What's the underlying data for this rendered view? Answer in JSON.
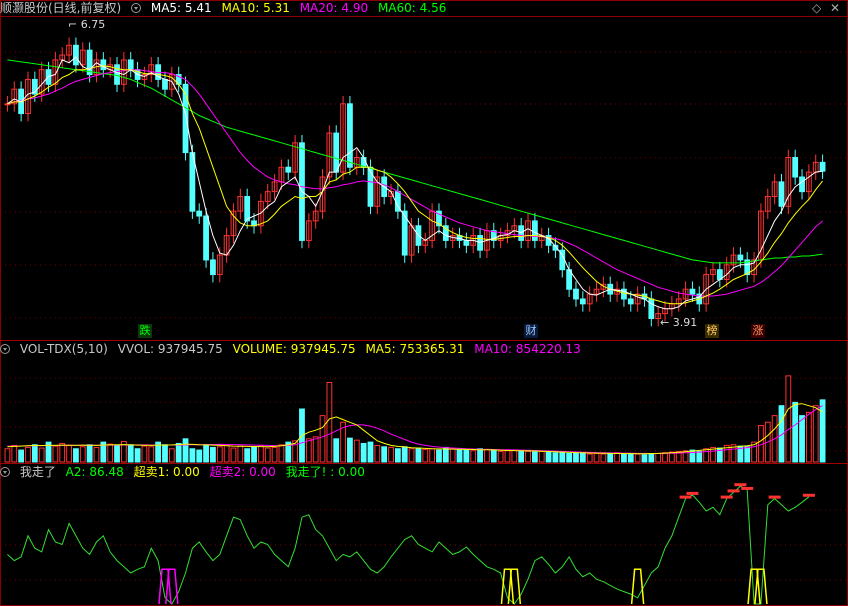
{
  "top": {
    "title": "顺灏股份(日线,前复权)",
    "ma5": "MA5: 5.41",
    "ma10": "MA10: 5.31",
    "ma20": "MA20: 4.90",
    "ma60": "MA60: 4.56",
    "high_mark": "6.75",
    "low_mark": "3.91",
    "tags": [
      "跌",
      "财",
      "榜",
      "涨"
    ]
  },
  "vol": {
    "title": "VOL-TDX(5,10)",
    "vvol": "VVOL: 937945.75",
    "volume": "VOLUME: 937945.75",
    "ma5": "MA5: 753365.31",
    "ma10": "MA10: 854220.13"
  },
  "ind": {
    "title": "我走了",
    "a2": "A2: 86.48",
    "s1": "超卖1: 0.00",
    "s2": "超卖2: 0.00",
    "go": "我走了! : 0.00"
  },
  "colors": {
    "up": "#ff3232",
    "down": "#54ffff",
    "ma5": "#ffffff",
    "ma10": "#ffff00",
    "ma20": "#ff00ff",
    "ma60": "#00ff00",
    "grid": "#7a0000"
  },
  "chart_data": [
    {
      "type": "candlestick",
      "title": "顺灏股份(日线,前复权)",
      "ylim": [
        3.7,
        7.0
      ],
      "annotations": [
        {
          "label": "6.75",
          "kind": "high"
        },
        {
          "label": "3.91",
          "kind": "low"
        }
      ],
      "close": [
        6.1,
        6.25,
        6.0,
        6.35,
        6.2,
        6.45,
        6.3,
        6.55,
        6.6,
        6.7,
        6.5,
        6.65,
        6.4,
        6.55,
        6.45,
        6.5,
        6.3,
        6.55,
        6.45,
        6.35,
        6.4,
        6.5,
        6.35,
        6.25,
        6.4,
        6.3,
        5.6,
        5.0,
        4.95,
        4.5,
        4.35,
        4.55,
        4.75,
        5.0,
        5.15,
        4.9,
        4.85,
        5.1,
        5.2,
        5.3,
        5.45,
        5.4,
        5.7,
        4.7,
        4.9,
        5.0,
        5.35,
        5.8,
        5.4,
        6.1,
        5.45,
        5.55,
        5.45,
        5.05,
        5.35,
        5.15,
        5.2,
        5.0,
        4.55,
        4.85,
        4.65,
        4.7,
        5.0,
        4.85,
        4.7,
        4.75,
        4.7,
        4.65,
        4.75,
        4.6,
        4.8,
        4.7,
        4.75,
        4.8,
        4.85,
        4.7,
        4.9,
        4.7,
        4.75,
        4.65,
        4.6,
        4.4,
        4.2,
        4.1,
        4.05,
        4.15,
        4.2,
        4.25,
        4.15,
        4.2,
        4.1,
        4.05,
        4.15,
        4.1,
        3.9,
        3.95,
        4.0,
        4.05,
        4.1,
        4.2,
        4.15,
        4.05,
        4.35,
        4.4,
        4.3,
        4.45,
        4.55,
        4.5,
        4.35,
        4.5,
        5.0,
        5.15,
        5.3,
        5.05,
        5.55,
        5.35,
        5.2,
        5.4,
        5.5,
        5.41
      ],
      "ma5": [
        6.1,
        6.15,
        6.12,
        6.2,
        6.22,
        6.3,
        6.38,
        6.4,
        6.55,
        6.52,
        6.58,
        6.48,
        6.45,
        6.52,
        6.48,
        6.45,
        6.42,
        6.4,
        6.45,
        6.4,
        6.38,
        6.42,
        6.38,
        6.35,
        6.33,
        6.2,
        6.0,
        5.6,
        5.3,
        5.0,
        4.75,
        4.57,
        4.55,
        4.65,
        4.8,
        4.92,
        4.95,
        4.98,
        5.05,
        5.1,
        5.25,
        5.3,
        5.35,
        5.2,
        5.15,
        5.05,
        5.2,
        5.4,
        5.4,
        5.55,
        5.6,
        5.65,
        5.55,
        5.4,
        5.3,
        5.25,
        5.2,
        5.05,
        4.95,
        4.85,
        4.75,
        4.7,
        4.75,
        4.8,
        4.75,
        4.73,
        4.72,
        4.7,
        4.7,
        4.68,
        4.7,
        4.72,
        4.75,
        4.76,
        4.8,
        4.78,
        4.82,
        4.78,
        4.75,
        4.72,
        4.64,
        4.55,
        4.4,
        4.3,
        4.2,
        4.15,
        4.14,
        4.17,
        4.2,
        4.19,
        4.18,
        4.15,
        4.12,
        4.1,
        4.05,
        4.02,
        4.0,
        4.0,
        4.02,
        4.08,
        4.1,
        4.12,
        4.2,
        4.25,
        4.3,
        4.35,
        4.42,
        4.45,
        4.45,
        4.47,
        4.6,
        4.75,
        4.9,
        5.0,
        5.15,
        5.25,
        5.3,
        5.35,
        5.4,
        5.41
      ],
      "ma10": [
        6.1,
        6.12,
        6.12,
        6.15,
        6.18,
        6.22,
        6.27,
        6.31,
        6.37,
        6.4,
        6.45,
        6.45,
        6.46,
        6.48,
        6.49,
        6.48,
        6.46,
        6.45,
        6.45,
        6.43,
        6.41,
        6.41,
        6.4,
        6.39,
        6.37,
        6.3,
        6.2,
        6.0,
        5.85,
        5.65,
        5.45,
        5.25,
        5.05,
        4.95,
        4.88,
        4.85,
        4.85,
        4.87,
        4.9,
        4.97,
        5.05,
        5.1,
        5.15,
        5.13,
        5.15,
        5.15,
        5.2,
        5.3,
        5.32,
        5.38,
        5.4,
        5.45,
        5.45,
        5.45,
        5.42,
        5.4,
        5.35,
        5.28,
        5.2,
        5.1,
        5.0,
        4.95,
        4.9,
        4.87,
        4.82,
        4.78,
        4.75,
        4.73,
        4.72,
        4.72,
        4.71,
        4.71,
        4.72,
        4.73,
        4.74,
        4.74,
        4.75,
        4.75,
        4.74,
        4.73,
        4.7,
        4.65,
        4.58,
        4.5,
        4.42,
        4.35,
        4.28,
        4.23,
        4.2,
        4.18,
        4.16,
        4.15,
        4.14,
        4.13,
        4.1,
        4.08,
        4.06,
        4.05,
        4.05,
        4.06,
        4.08,
        4.1,
        4.13,
        4.16,
        4.2,
        4.25,
        4.3,
        4.33,
        4.36,
        4.4,
        4.48,
        4.57,
        4.68,
        4.77,
        4.88,
        4.97,
        5.05,
        5.12,
        5.22,
        5.31
      ],
      "ma20": [
        6.1,
        6.12,
        6.13,
        6.15,
        6.16,
        6.18,
        6.2,
        6.23,
        6.26,
        6.3,
        6.33,
        6.35,
        6.37,
        6.39,
        6.41,
        6.42,
        6.43,
        6.44,
        6.45,
        6.45,
        6.44,
        6.43,
        6.42,
        6.42,
        6.41,
        6.38,
        6.35,
        6.28,
        6.2,
        6.1,
        6.0,
        5.9,
        5.8,
        5.7,
        5.6,
        5.52,
        5.45,
        5.4,
        5.35,
        5.32,
        5.3,
        5.28,
        5.27,
        5.25,
        5.24,
        5.23,
        5.23,
        5.24,
        5.25,
        5.27,
        5.28,
        5.3,
        5.31,
        5.3,
        5.29,
        5.27,
        5.24,
        5.2,
        5.16,
        5.12,
        5.08,
        5.04,
        5.0,
        4.97,
        4.94,
        4.91,
        4.88,
        4.86,
        4.84,
        4.82,
        4.8,
        4.79,
        4.78,
        4.77,
        4.76,
        4.75,
        4.75,
        4.74,
        4.74,
        4.73,
        4.72,
        4.7,
        4.67,
        4.64,
        4.6,
        4.56,
        4.52,
        4.48,
        4.44,
        4.4,
        4.37,
        4.34,
        4.31,
        4.28,
        4.25,
        4.22,
        4.2,
        4.18,
        4.16,
        4.15,
        4.14,
        4.13,
        4.13,
        4.13,
        4.14,
        4.15,
        4.17,
        4.19,
        4.21,
        4.23,
        4.27,
        4.32,
        4.38,
        4.44,
        4.52,
        4.6,
        4.68,
        4.76,
        4.84,
        4.9
      ],
      "ma60": [
        6.55,
        6.54,
        6.53,
        6.52,
        6.51,
        6.5,
        6.49,
        6.48,
        6.47,
        6.46,
        6.45,
        6.44,
        6.43,
        6.42,
        6.41,
        6.4,
        6.39,
        6.37,
        6.35,
        6.32,
        6.29,
        6.26,
        6.22,
        6.18,
        6.14,
        6.1,
        6.06,
        6.02,
        5.98,
        5.95,
        5.92,
        5.89,
        5.86,
        5.84,
        5.82,
        5.8,
        5.78,
        5.76,
        5.74,
        5.72,
        5.7,
        5.68,
        5.66,
        5.64,
        5.62,
        5.6,
        5.58,
        5.56,
        5.54,
        5.52,
        5.5,
        5.48,
        5.46,
        5.44,
        5.42,
        5.4,
        5.38,
        5.36,
        5.34,
        5.32,
        5.3,
        5.28,
        5.26,
        5.24,
        5.22,
        5.2,
        5.18,
        5.16,
        5.14,
        5.12,
        5.1,
        5.08,
        5.06,
        5.04,
        5.02,
        5.0,
        4.98,
        4.96,
        4.94,
        4.92,
        4.9,
        4.88,
        4.86,
        4.84,
        4.82,
        4.8,
        4.78,
        4.76,
        4.74,
        4.72,
        4.7,
        4.68,
        4.66,
        4.64,
        4.62,
        4.6,
        4.58,
        4.56,
        4.54,
        4.52,
        4.5,
        4.49,
        4.48,
        4.47,
        4.47,
        4.47,
        4.47,
        4.47,
        4.48,
        4.49,
        4.5,
        4.51,
        4.52,
        4.52,
        4.53,
        4.53,
        4.54,
        4.54,
        4.55,
        4.56
      ]
    },
    {
      "type": "bar",
      "title": "VOL-TDX(5,10)",
      "ylim": [
        0,
        1600000
      ],
      "values": [
        200000,
        250000,
        180000,
        220000,
        260000,
        210000,
        300000,
        240000,
        280000,
        250000,
        200000,
        230000,
        260000,
        220000,
        300000,
        270000,
        250000,
        310000,
        260000,
        200000,
        240000,
        230000,
        300000,
        260000,
        200000,
        280000,
        350000,
        200000,
        180000,
        260000,
        220000,
        230000,
        260000,
        210000,
        240000,
        200000,
        230000,
        250000,
        210000,
        220000,
        260000,
        300000,
        320000,
        800000,
        350000,
        380000,
        700000,
        1200000,
        350000,
        600000,
        360000,
        330000,
        280000,
        300000,
        250000,
        230000,
        220000,
        200000,
        230000,
        200000,
        210000,
        190000,
        200000,
        180000,
        220000,
        200000,
        190000,
        180000,
        170000,
        200000,
        190000,
        180000,
        160000,
        170000,
        180000,
        170000,
        160000,
        150000,
        160000,
        150000,
        140000,
        150000,
        130000,
        140000,
        130000,
        120000,
        130000,
        120000,
        130000,
        140000,
        120000,
        130000,
        120000,
        110000,
        120000,
        130000,
        140000,
        150000,
        160000,
        170000,
        180000,
        160000,
        200000,
        220000,
        210000,
        250000,
        260000,
        240000,
        230000,
        300000,
        550000,
        600000,
        700000,
        850000,
        1300000,
        900000,
        700000,
        750000,
        850000,
        937945.75
      ],
      "ma5": [
        230000,
        235000,
        240000,
        245000,
        250000,
        248000,
        252000,
        250000,
        255000,
        252000,
        250000,
        255000,
        252000,
        250000,
        256000,
        258000,
        260000,
        262000,
        258000,
        255000,
        252000,
        250000,
        255000,
        256000,
        258000,
        262000,
        270000,
        265000,
        260000,
        258000,
        255000,
        250000,
        245000,
        240000,
        238000,
        236000,
        234000,
        232000,
        230000,
        235000,
        245000,
        260000,
        280000,
        400000,
        450000,
        480000,
        520000,
        650000,
        680000,
        640000,
        600000,
        560000,
        480000,
        400000,
        320000,
        280000,
        250000,
        235000,
        228000,
        215000,
        212000,
        205000,
        200000,
        198000,
        196000,
        194000,
        192000,
        190000,
        188000,
        186000,
        184000,
        182000,
        178000,
        174000,
        172000,
        170000,
        168000,
        166000,
        162000,
        158000,
        154000,
        150000,
        146000,
        142000,
        140000,
        136000,
        134000,
        132000,
        130000,
        128000,
        128000,
        127000,
        126000,
        126000,
        128000,
        130000,
        135000,
        140000,
        148000,
        155000,
        165000,
        175000,
        185000,
        195000,
        205000,
        215000,
        225000,
        235000,
        245000,
        260000,
        320000,
        400000,
        500000,
        620000,
        800000,
        870000,
        880000,
        850000,
        820000,
        753365.31
      ],
      "ma10": [
        240000,
        240000,
        242000,
        244000,
        246000,
        248000,
        249000,
        250000,
        251000,
        252000,
        253000,
        254000,
        254000,
        254000,
        255000,
        255000,
        256000,
        257000,
        258000,
        258000,
        258000,
        257000,
        256000,
        256000,
        256000,
        257000,
        258000,
        259000,
        260000,
        262000,
        264000,
        265000,
        264000,
        262000,
        260000,
        258000,
        255000,
        252000,
        250000,
        248000,
        248000,
        252000,
        260000,
        290000,
        320000,
        350000,
        380000,
        420000,
        470000,
        520000,
        550000,
        560000,
        560000,
        540000,
        510000,
        470000,
        420000,
        380000,
        340000,
        300000,
        270000,
        250000,
        235000,
        225000,
        218000,
        212000,
        206000,
        200000,
        196000,
        192000,
        190000,
        188000,
        186000,
        184000,
        182000,
        180000,
        177000,
        174000,
        171000,
        168000,
        164000,
        160000,
        156000,
        152000,
        148000,
        145000,
        142000,
        140000,
        138000,
        136000,
        134000,
        132000,
        130000,
        130000,
        129000,
        129000,
        130000,
        132000,
        135000,
        139000,
        144000,
        150000,
        157000,
        165000,
        174000,
        184000,
        195000,
        206000,
        217000,
        230000,
        260000,
        300000,
        350000,
        410000,
        490000,
        560000,
        640000,
        720000,
        790000,
        854220.13
      ]
    },
    {
      "type": "line",
      "title": "我走了",
      "series": [
        {
          "name": "A2",
          "values": [
            40,
            35,
            38,
            55,
            45,
            42,
            60,
            50,
            48,
            65,
            55,
            45,
            40,
            50,
            55,
            42,
            35,
            30,
            25,
            28,
            30,
            45,
            35,
            5,
            0,
            10,
            25,
            45,
            50,
            42,
            35,
            40,
            55,
            70,
            68,
            55,
            45,
            50,
            48,
            40,
            35,
            30,
            45,
            70,
            72,
            60,
            55,
            45,
            35,
            40,
            38,
            42,
            35,
            28,
            25,
            30,
            38,
            45,
            52,
            55,
            48,
            45,
            42,
            50,
            45,
            40,
            42,
            46,
            40,
            35,
            30,
            28,
            25,
            5,
            0,
            8,
            20,
            35,
            38,
            32,
            25,
            30,
            38,
            28,
            22,
            25,
            20,
            18,
            15,
            12,
            10,
            8,
            5,
            15,
            25,
            30,
            45,
            55,
            70,
            85,
            88,
            82,
            75,
            78,
            72,
            85,
            90,
            95,
            92,
            0,
            0,
            80,
            85,
            80,
            75,
            78,
            82,
            86.48
          ]
        },
        {
          "name": "超卖1",
          "values": [
            0
          ]
        },
        {
          "name": "超卖2",
          "values": [
            0
          ]
        },
        {
          "name": "我走了!",
          "values": [
            0
          ]
        }
      ]
    }
  ]
}
